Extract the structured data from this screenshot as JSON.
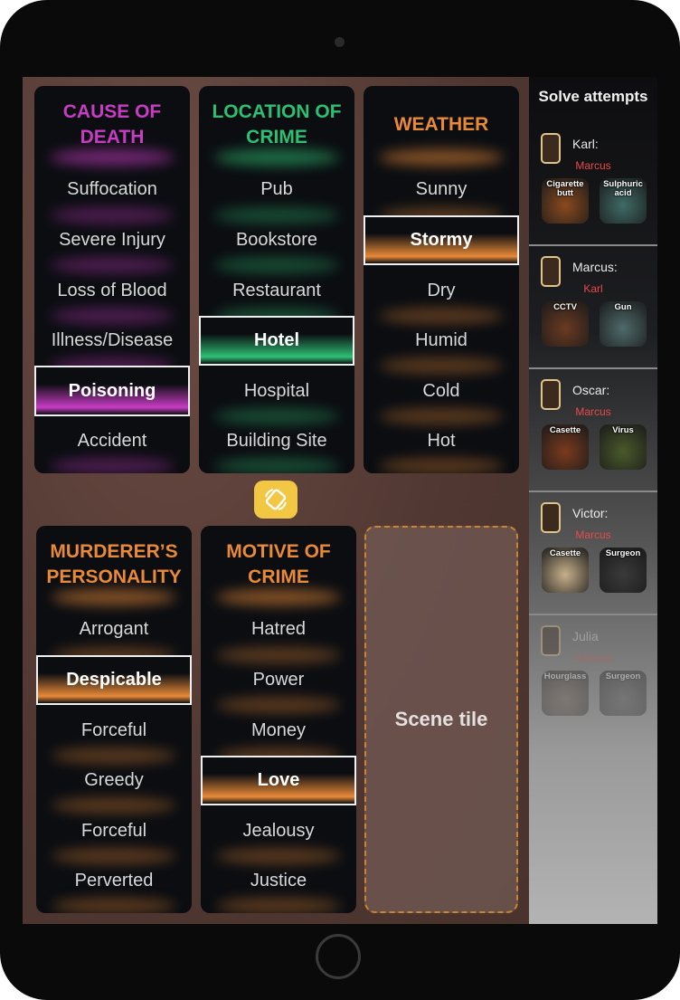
{
  "cards": [
    {
      "title": "CAUSE OF DEATH",
      "color": "#c83cc4",
      "options": [
        "Suffocation",
        "Severe Injury",
        "Loss of Blood",
        "Illness/Disease",
        "Poisoning",
        "Accident"
      ],
      "selected_index": 4
    },
    {
      "title": "LOCATION OF CRIME",
      "color": "#2fbf73",
      "options": [
        "Pub",
        "Bookstore",
        "Restaurant",
        "Hotel",
        "Hospital",
        "Building Site"
      ],
      "selected_index": 3
    },
    {
      "title": "WEATHER",
      "color": "#e88a38",
      "options": [
        "Sunny",
        "Stormy",
        "Dry",
        "Humid",
        "Cold",
        "Hot"
      ],
      "selected_index": 1
    },
    {
      "title": "MURDERER’S PERSONALITY",
      "color": "#e88a38",
      "options": [
        "Arrogant",
        "Despicable",
        "Forceful",
        "Greedy",
        "Forceful",
        "Perverted"
      ],
      "selected_index": 1
    },
    {
      "title": "MOTIVE OF CRIME",
      "color": "#e88a38",
      "options": [
        "Hatred",
        "Power",
        "Money",
        "Love",
        "Jealousy",
        "Justice"
      ],
      "selected_index": 3
    }
  ],
  "scene_tile": {
    "label": "Scene tile"
  },
  "rotate_button": {
    "icon": "rotate-icon"
  },
  "sidebar": {
    "title": "Solve attempts",
    "attempts": [
      {
        "player": "Karl:",
        "suspect": "Marcus",
        "tiles": [
          "Cigarette butt",
          "Sulphuric acid"
        ]
      },
      {
        "player": "Marcus:",
        "suspect": "Karl",
        "tiles": [
          "CCTV",
          "Gun"
        ]
      },
      {
        "player": "Oscar:",
        "suspect": "Marcus",
        "tiles": [
          "Casette",
          "Virus"
        ]
      },
      {
        "player": "Victor:",
        "suspect": "Marcus",
        "tiles": [
          "Casette",
          "Surgeon"
        ]
      },
      {
        "player": "Julia",
        "suspect": "Marcus",
        "tiles": [
          "Hourglass",
          "Surgeon"
        ]
      }
    ]
  },
  "colors": {
    "selected_orange": "#f0a020",
    "selected_green": "#1ccf78",
    "selected_purple": "#c020c0",
    "accent": "#f2c744"
  }
}
